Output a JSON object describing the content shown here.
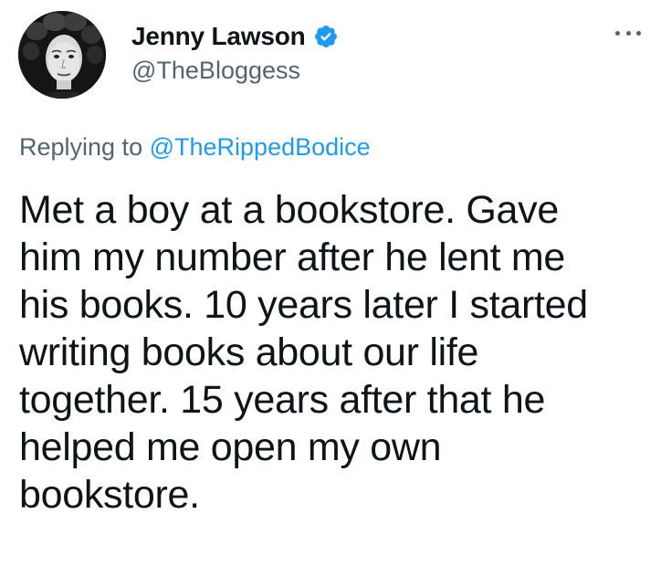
{
  "author": {
    "display_name": "Jenny Lawson",
    "handle": "@TheBloggess",
    "verified": true,
    "avatar_icon": "profile-photo-avatar"
  },
  "reply": {
    "prefix": "Replying to",
    "mention": "@TheRippedBodice"
  },
  "tweet": {
    "text": "Met a boy at a bookstore. Gave\nhim my number after he lent me\nhis books. 10 years later I started\nwriting books about our life\ntogether. 15 years after that he\nhelped me open my own\nbookstore."
  },
  "menu": {
    "icon": "more-options-icon"
  },
  "colors": {
    "text": "#0f1419",
    "secondary": "#536471",
    "accent": "#1d9bf0"
  }
}
